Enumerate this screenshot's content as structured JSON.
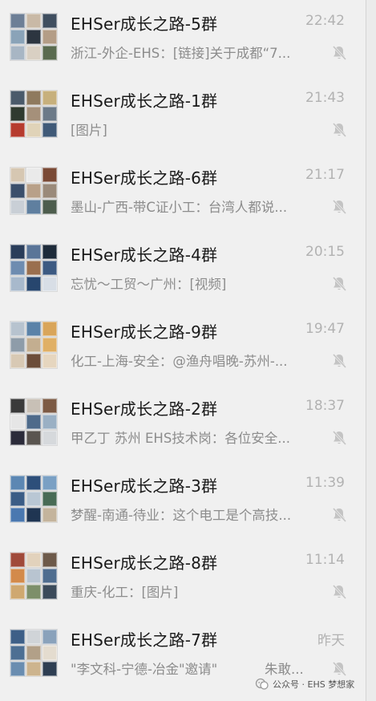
{
  "chats": [
    {
      "title": "EHSer成长之路-5群",
      "time": "22:42",
      "preview": "浙江-外企-EHS：[链接]关于成都“7...",
      "muted": true
    },
    {
      "title": "EHSer成长之路-1群",
      "time": "21:43",
      "preview": "[图片]",
      "muted": true
    },
    {
      "title": "EHSer成长之路-6群",
      "time": "21:17",
      "preview": "墨山-广西-带C证小工：台湾人都说...",
      "muted": true
    },
    {
      "title": "EHSer成长之路-4群",
      "time": "20:15",
      "preview": "忘忧～工贸～广州：[视频]",
      "muted": true
    },
    {
      "title": "EHSer成长之路-9群",
      "time": "19:47",
      "preview": "化工-上海-安全：@渔舟唱晚-苏州-...",
      "muted": true
    },
    {
      "title": "EHSer成长之路-2群",
      "time": "18:37",
      "preview": "甲乙丁 苏州 EHS技术岗：各位安全...",
      "muted": true
    },
    {
      "title": "EHSer成长之路-3群",
      "time": "11:39",
      "preview": "梦醒-南通-待业：这个电工是个高技...",
      "muted": true
    },
    {
      "title": "EHSer成长之路-8群",
      "time": "11:14",
      "preview": "重庆-化工：[图片]",
      "muted": true
    },
    {
      "title": "EHSer成长之路-7群",
      "time": "昨天",
      "preview": "\"李文科-宁德-冶金\"邀请\"",
      "preview_extra": "朱敢...",
      "muted": true
    }
  ],
  "watermark": {
    "text": "公众号 · EHS 梦想家",
    "icon": "wechat-official-account-icon"
  },
  "colors": {
    "background": "#f0f0f0",
    "title": "#1a1a1a",
    "time": "#b2b2b2",
    "preview": "#8c8c8c",
    "mute_icon": "#c4c4c4"
  }
}
